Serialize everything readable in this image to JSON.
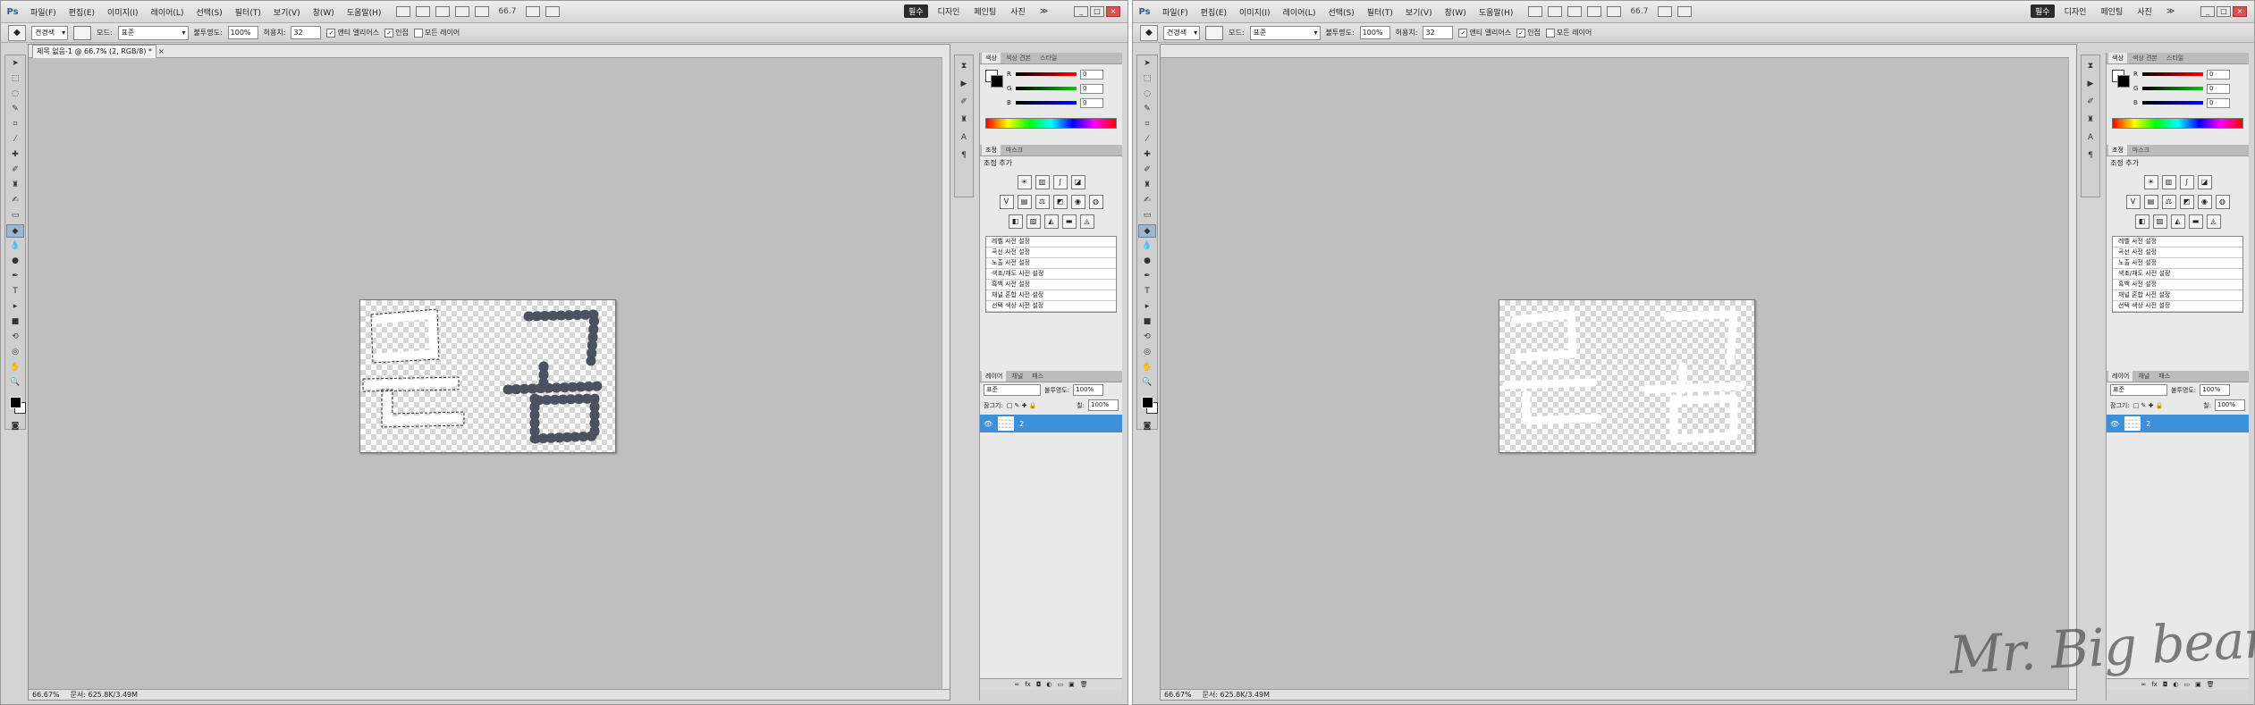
{
  "menubar": {
    "logo": "Ps",
    "items": [
      "파일(F)",
      "편집(E)",
      "이미지(I)",
      "레이어(L)",
      "선택(S)",
      "필터(T)",
      "보기(V)",
      "창(W)",
      "도움말(H)"
    ],
    "zoom": "66.7",
    "workspaces": [
      "필수",
      "디자인",
      "페인팅",
      "사진"
    ],
    "more": "≫"
  },
  "options": {
    "preset": "견경색",
    "mode_label": "모드:",
    "mode_value": "표준",
    "opacity_label": "불투명도:",
    "opacity_value": "100%",
    "tolerance_label": "허용치:",
    "tolerance_value": "32",
    "antialias_label": "앤티 앨리어스",
    "contiguous_label": "인접",
    "all_layers_label": "모든 레이어"
  },
  "document": {
    "tab_title": "제목 없음-1 @ 66.7% (2, RGB/8) *",
    "close": "×",
    "zoom_status": "66.67%",
    "doc_size": "문서: 625.8K/3.49M"
  },
  "panels": {
    "color_tabs": [
      "색상",
      "색상 견본",
      "스타일"
    ],
    "rgb": [
      {
        "label": "R",
        "value": "0"
      },
      {
        "label": "G",
        "value": "0"
      },
      {
        "label": "B",
        "value": "0"
      }
    ],
    "adj_tabs": [
      "조정",
      "마스크"
    ],
    "adj_title": "조정 추가",
    "presets": [
      "레벨 사전 설정",
      "곡선 사전 설정",
      "노출 사전 설정",
      "색조/채도 사전 설정",
      "흑백 사전 설정",
      "채널 혼합 사전 설정",
      "선택 색상 사전 설정"
    ],
    "layer_tabs": [
      "레이어",
      "채널",
      "패스"
    ],
    "blend_mode": "표준",
    "opacity_label": "불투명도:",
    "opacity_value": "100%",
    "lock_label": "잠그기:",
    "fill_label": "칠:",
    "fill_value": "100%",
    "layer_name": "2"
  },
  "canvas_text": "큰곰",
  "colors": {
    "stroke_dark": "#4a5260",
    "stroke_white": "#ffffff",
    "selection": "#3c8fd9"
  },
  "watermark": "Mr. Big bear."
}
